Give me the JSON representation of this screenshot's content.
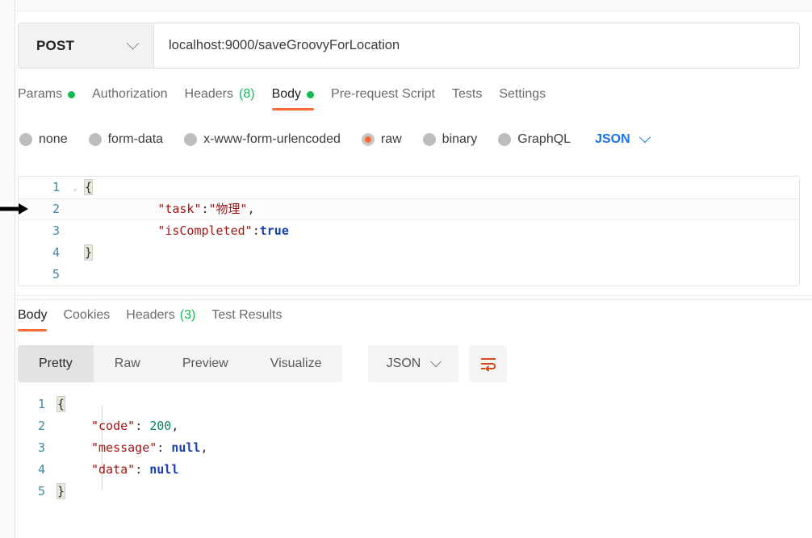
{
  "request": {
    "method": "POST",
    "method_icon": "chevron-down-icon",
    "url": "localhost:9000/saveGroovyForLocation",
    "tabs": [
      {
        "label": "Params",
        "badge_dot": true,
        "active": false
      },
      {
        "label": "Authorization",
        "active": false
      },
      {
        "label": "Headers",
        "count": "(8)",
        "active": false
      },
      {
        "label": "Body",
        "badge_dot": true,
        "active": true
      },
      {
        "label": "Pre-request Script",
        "active": false
      },
      {
        "label": "Tests",
        "active": false
      },
      {
        "label": "Settings",
        "active": false
      }
    ],
    "body_types": [
      {
        "label": "none",
        "checked": false
      },
      {
        "label": "form-data",
        "checked": false
      },
      {
        "label": "x-www-form-urlencoded",
        "checked": false
      },
      {
        "label": "raw",
        "checked": true
      },
      {
        "label": "binary",
        "checked": false
      },
      {
        "label": "GraphQL",
        "checked": false
      }
    ],
    "raw_format": "JSON",
    "raw_format_icon": "chevron-down-icon",
    "editor": {
      "lines": [
        {
          "num": "1",
          "fold": "⌄",
          "open_brace": "{"
        },
        {
          "num": "2",
          "active": true,
          "key": "\"task\"",
          "colon": ":",
          "value": "\"物理\"",
          "comma": ","
        },
        {
          "num": "3",
          "key": "\"isCompleted\"",
          "colon": ":",
          "bool": "true"
        },
        {
          "num": "4",
          "close_brace": "}"
        },
        {
          "num": "5"
        }
      ]
    }
  },
  "response": {
    "tabs": [
      {
        "label": "Body",
        "active": true
      },
      {
        "label": "Cookies",
        "active": false
      },
      {
        "label": "Headers",
        "count": "(3)",
        "active": false
      },
      {
        "label": "Test Results",
        "active": false
      }
    ],
    "view_modes": [
      {
        "label": "Pretty",
        "active": true
      },
      {
        "label": "Raw",
        "active": false
      },
      {
        "label": "Preview",
        "active": false
      },
      {
        "label": "Visualize",
        "active": false
      }
    ],
    "format": "JSON",
    "format_icon": "chevron-down-icon",
    "wrap_icon": "word-wrap-icon",
    "body": {
      "lines": [
        {
          "num": "1",
          "open_brace": "{"
        },
        {
          "num": "2",
          "key": "\"code\"",
          "colon": ":",
          "num_value": "200",
          "comma": ","
        },
        {
          "num": "3",
          "key": "\"message\"",
          "colon": ":",
          "null_value": "null",
          "comma": ","
        },
        {
          "num": "4",
          "key": "\"data\"",
          "colon": ":",
          "null_value": "null"
        },
        {
          "num": "5",
          "close_brace": "}"
        }
      ]
    }
  },
  "colors": {
    "accent": "#ff6c37",
    "success": "#11bb52",
    "link": "#1572e8",
    "string": "#a31515",
    "number": "#098658",
    "keyword": "#1a3fb0"
  },
  "cursor": {
    "icon": "arrow-pointer-right-icon"
  }
}
